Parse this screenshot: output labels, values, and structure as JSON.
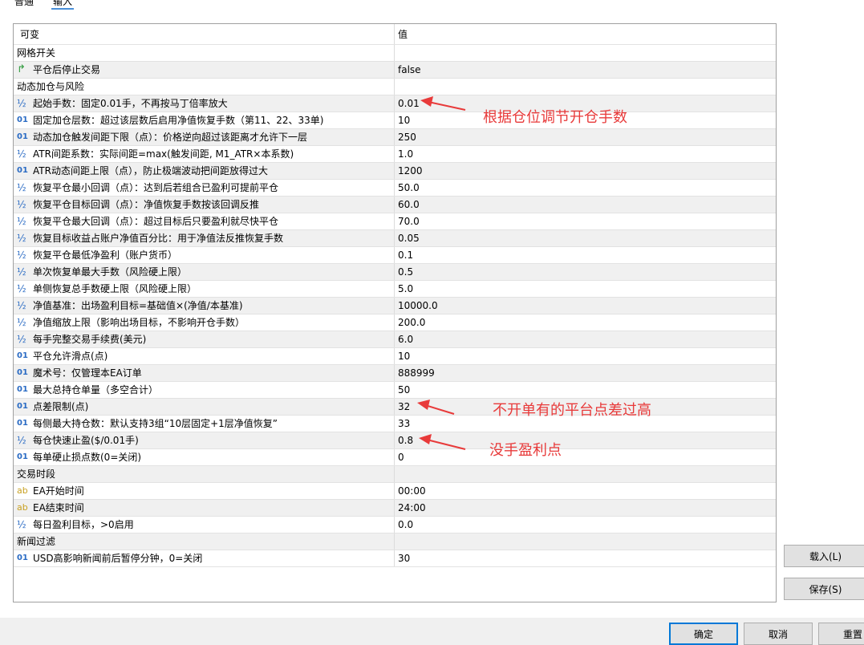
{
  "tabs": {
    "normal": "普通",
    "input": "输入"
  },
  "table": {
    "header_name": "可变",
    "header_value": "值",
    "rows": [
      {
        "kind": "group",
        "name": "网格开关",
        "value": ""
      },
      {
        "kind": "param",
        "icon": "bool",
        "name": "平仓后停止交易",
        "value": "false"
      },
      {
        "kind": "group",
        "name": "动态加仓与风险",
        "value": ""
      },
      {
        "kind": "param",
        "icon": "frac",
        "name": "起始手数：固定0.01手，不再按马丁倍率放大",
        "value": "0.01"
      },
      {
        "kind": "param",
        "icon": "int",
        "name": "固定加仓层数：超过该层数后启用净值恢复手数（第11、22、33单)",
        "value": "10"
      },
      {
        "kind": "param",
        "icon": "int",
        "name": "动态加仓触发间距下限（点）：价格逆向超过该距离才允许下一层",
        "value": "250"
      },
      {
        "kind": "param",
        "icon": "frac",
        "name": "ATR间距系数：实际间距=max(触发间距, M1_ATR×本系数)",
        "value": "1.0"
      },
      {
        "kind": "param",
        "icon": "int",
        "name": "ATR动态间距上限（点），防止极端波动把间距放得过大",
        "value": "1200"
      },
      {
        "kind": "param",
        "icon": "frac",
        "name": "恢复平仓最小回调（点）：达到后若组合已盈利可提前平仓",
        "value": "50.0"
      },
      {
        "kind": "param",
        "icon": "frac",
        "name": "恢复平仓目标回调（点）：净值恢复手数按该回调反推",
        "value": "60.0"
      },
      {
        "kind": "param",
        "icon": "frac",
        "name": "恢复平仓最大回调（点）：超过目标后只要盈利就尽快平仓",
        "value": "70.0"
      },
      {
        "kind": "param",
        "icon": "frac",
        "name": "恢复目标收益占账户净值百分比：用于净值法反推恢复手数",
        "value": "0.05"
      },
      {
        "kind": "param",
        "icon": "frac",
        "name": "恢复平仓最低净盈利（账户货币）",
        "value": "0.1"
      },
      {
        "kind": "param",
        "icon": "frac",
        "name": "单次恢复单最大手数（风险硬上限）",
        "value": "0.5"
      },
      {
        "kind": "param",
        "icon": "frac",
        "name": "单侧恢复总手数硬上限（风险硬上限）",
        "value": "5.0"
      },
      {
        "kind": "param",
        "icon": "frac",
        "name": "净值基准：出场盈利目标=基础值×(净值/本基准)",
        "value": "10000.0"
      },
      {
        "kind": "param",
        "icon": "frac",
        "name": "净值缩放上限（影响出场目标，不影响开仓手数）",
        "value": "200.0"
      },
      {
        "kind": "param",
        "icon": "frac",
        "name": "每手完整交易手续费(美元)",
        "value": "6.0"
      },
      {
        "kind": "param",
        "icon": "int",
        "name": "平仓允许滑点(点)",
        "value": "10"
      },
      {
        "kind": "param",
        "icon": "int",
        "name": "魔术号：仅管理本EA订单",
        "value": "888999"
      },
      {
        "kind": "param",
        "icon": "int",
        "name": "最大总持仓单量（多空合计）",
        "value": "50"
      },
      {
        "kind": "param",
        "icon": "int",
        "name": "点差限制(点)",
        "value": "32"
      },
      {
        "kind": "param",
        "icon": "int",
        "name": "每侧最大持仓数：默认支持3组“10层固定+1层净值恢复”",
        "value": "33"
      },
      {
        "kind": "param",
        "icon": "frac",
        "name": "每仓快速止盈($/0.01手)",
        "value": "0.8"
      },
      {
        "kind": "param",
        "icon": "int",
        "name": "每单硬止损点数(0=关闭)",
        "value": "0"
      },
      {
        "kind": "group",
        "name": "交易时段",
        "value": ""
      },
      {
        "kind": "param",
        "icon": "ab",
        "name": "EA开始时间",
        "value": "00:00"
      },
      {
        "kind": "param",
        "icon": "ab",
        "name": "EA结束时间",
        "value": "24:00"
      },
      {
        "kind": "param",
        "icon": "frac",
        "name": "每日盈利目标，>0启用",
        "value": "0.0"
      },
      {
        "kind": "group",
        "name": "新闻过滤",
        "value": ""
      },
      {
        "kind": "param",
        "icon": "int",
        "name": "USD高影响新闻前后暂停分钟，0=关闭",
        "value": "30"
      }
    ]
  },
  "icons": {
    "bool": "↱",
    "frac": "½",
    "int": "01",
    "ab": "ab"
  },
  "buttons": {
    "load": "载入(L)",
    "save": "保存(S)",
    "ok": "确定",
    "cancel": "取消",
    "reset": "重置"
  },
  "annotations": {
    "lot_note": "根据仓位调节开仓手数",
    "spread_note": "不开单有的平台点差过高",
    "tp_note": "没手盈利点"
  },
  "colors": {
    "annotation": "#e83a3a",
    "accent": "#0078d7",
    "row_alt": "#f0f0f0"
  }
}
